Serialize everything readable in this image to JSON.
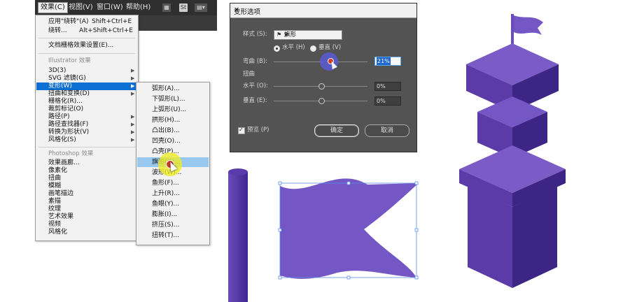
{
  "menubar": {
    "items": [
      "效果(C)",
      "视图(V)",
      "窗口(W)",
      "帮助(H)"
    ],
    "icons": [
      "grid-icon",
      "stock-icon",
      "layout-icon"
    ]
  },
  "effect_menu": {
    "apply_last": "应用\"绕转\"(A)",
    "apply_last_shortcut": "Shift+Ctrl+E",
    "last_effect": "绕转...",
    "last_effect_shortcut": "Alt+Shift+Ctrl+E",
    "raster_settings": "文档栅格效果设置(E)...",
    "illustrator_header": "Illustrator 效果",
    "illustrator_items": [
      "3D(3)",
      "SVG 滤镜(G)",
      "变形(W)",
      "扭曲和变换(D)",
      "栅格化(R)...",
      "裁剪标记(O)",
      "路径(P)",
      "路径查找器(F)",
      "转换为形状(V)",
      "风格化(S)"
    ],
    "photoshop_header": "Photoshop 效果",
    "photoshop_items": [
      "效果画廊...",
      "像素化",
      "扭曲",
      "模糊",
      "画笔描边",
      "素描",
      "纹理",
      "艺术效果",
      "视频",
      "风格化"
    ]
  },
  "warp_submenu": {
    "items": [
      "弧形(A)...",
      "下弧形(L)...",
      "上弧形(U)...",
      "拱形(H)...",
      "凸出(B)...",
      "凹壳(O)...",
      "凸壳(P)...",
      "旗形(G)...",
      "波形(W)...",
      "鱼形(F)...",
      "上升(R)...",
      "鱼眼(Y)...",
      "膨胀(I)...",
      "挤压(S)...",
      "扭转(T)..."
    ]
  },
  "dialog": {
    "title": "变形选项",
    "style_label": "样式 (S):",
    "style_value": "旗形",
    "horizontal_label": "水平 (H)",
    "vertical_label": "垂直 (V)",
    "bend_label": "弯曲 (B):",
    "bend_value": "21%",
    "distort_label": "扭曲",
    "h_label": "水平 (O):",
    "h_value": "0%",
    "v_label": "垂直 (E):",
    "v_value": "0%",
    "preview_label": "预览 (P)",
    "ok_label": "确定",
    "cancel_label": "取消"
  },
  "colors": {
    "purple_light": "#7b5cc6",
    "purple_mid": "#5b3ba8",
    "purple_dark": "#3d2585",
    "menu_highlight": "#0d6fd1",
    "dialog_bg": "#535353"
  }
}
